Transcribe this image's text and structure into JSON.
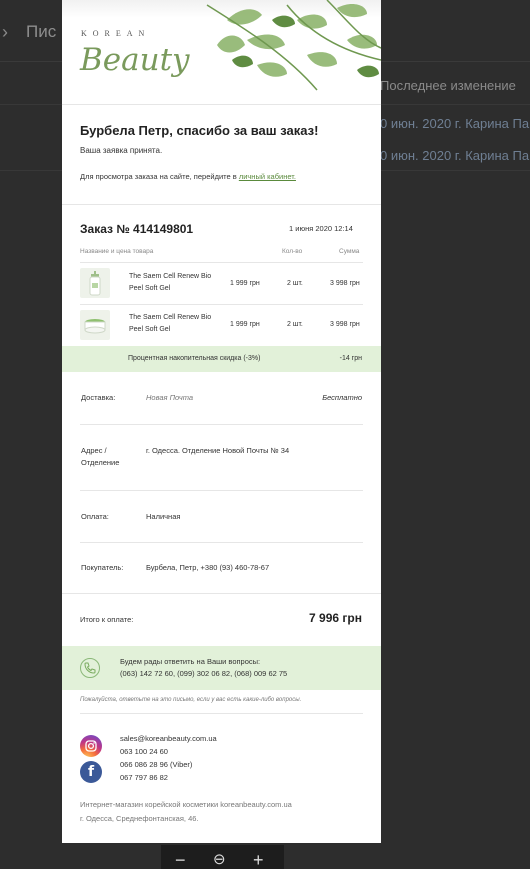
{
  "background": {
    "breadcrumb_title": "Пис",
    "column_header": "Последнее изменение",
    "rows": [
      {
        "date": "0 июн. 2020 г.",
        "author": "Карина Па"
      },
      {
        "date": "0 июн. 2020 г.",
        "author": "Карина Па"
      }
    ]
  },
  "email": {
    "logo_top": "KOREAN",
    "logo_bottom": "Beauty",
    "greeting": "Бурбела Петр, спасибо за ваш заказ!",
    "accepted": "Ваша заявка принята.",
    "view_prefix": "Для просмотра заказа на сайте, перейдите в ",
    "view_link": "личный кабинет.",
    "order_title": "Заказ № 414149801",
    "order_date": "1 июня 2020 12:14",
    "table_headers": {
      "name": "Название и цена товара",
      "qty": "Кол-во",
      "sum": "Сумма"
    },
    "products": [
      {
        "name": "The Saem Cell Renew Bio Peel Soft Gel",
        "price": "1 999 грн",
        "qty": "2 шт.",
        "sum": "3 998 грн"
      },
      {
        "name": "The Saem Cell Renew Bio Peel Soft Gel",
        "price": "1 999 грн",
        "qty": "2 шт.",
        "sum": "3 998 грн"
      }
    ],
    "discount": {
      "label": "Процентная накопительная скидка (-3%)",
      "value": "-14 грн"
    },
    "delivery": {
      "label": "Доставка:",
      "method": "Новая Почта",
      "price": "Бесплатно"
    },
    "address": {
      "label": "Адрес / Отделение",
      "value": "г. Одесса. Отделение Новой Почты № 34"
    },
    "payment": {
      "label": "Оплата:",
      "value": "Наличная"
    },
    "buyer": {
      "label": "Покупатель:",
      "value": "Бурбела, Петр, +380 (93) 460-78-67"
    },
    "total": {
      "label": "Итого к оплате:",
      "value": "7 996 грн"
    },
    "help": {
      "title": "Будем рады ответить на Ваши вопросы:",
      "phones": "(063) 142 72 60, (099) 302 06 82, (068) 009 62 75"
    },
    "note": "Пожалуйста, ответьте на это письмо, если у вас есть какие-либо вопросы.",
    "contacts": [
      "sales@koreanbeauty.com.ua",
      "063 100 24 60",
      "066 086 28 96 (Viber)",
      "067 797 86 82"
    ],
    "footer": [
      "Интернет-магазин корейской косметики koreanbeauty.com.ua",
      "г. Одесса, Среднефонтанская, 46."
    ]
  },
  "zoom": {
    "minus": "−",
    "reset": "⊖",
    "plus": "+"
  },
  "colors": {
    "accent_green": "#5a8a3c",
    "highlight_bg": "#e2f1d9"
  }
}
